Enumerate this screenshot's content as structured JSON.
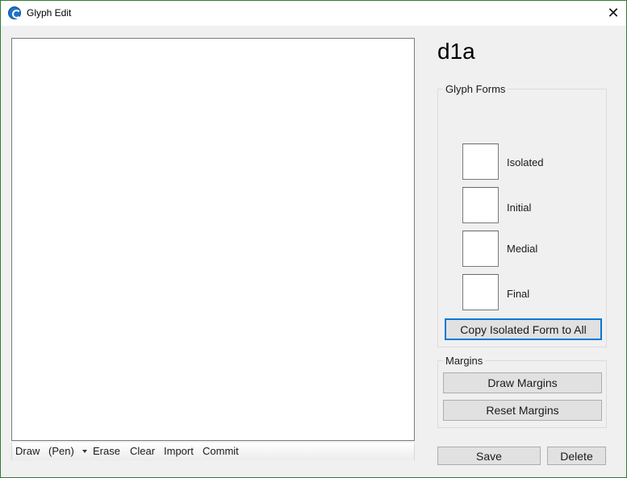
{
  "window": {
    "title": "Glyph Edit",
    "icon": "app-logo-icon",
    "close_glyph": "✕"
  },
  "toolbar": {
    "draw": "Draw",
    "pen": "(Pen)",
    "erase": "Erase",
    "clear": "Clear",
    "import": "Import",
    "commit": "Commit"
  },
  "glyph": {
    "name": "d1a"
  },
  "glyph_forms": {
    "label": "Glyph Forms",
    "forms": [
      {
        "label": "Isolated"
      },
      {
        "label": "Initial"
      },
      {
        "label": "Medial"
      },
      {
        "label": "Final"
      }
    ],
    "copy_button": "Copy Isolated Form to All"
  },
  "margins": {
    "label": "Margins",
    "draw_button": "Draw Margins",
    "reset_button": "Reset Margins"
  },
  "actions": {
    "save": "Save",
    "delete": "Delete"
  },
  "colors": {
    "accent": "#0078d7",
    "window_border": "#2e7d32",
    "panel_bg": "#f0f0f0",
    "button_bg": "#e1e1e1"
  }
}
